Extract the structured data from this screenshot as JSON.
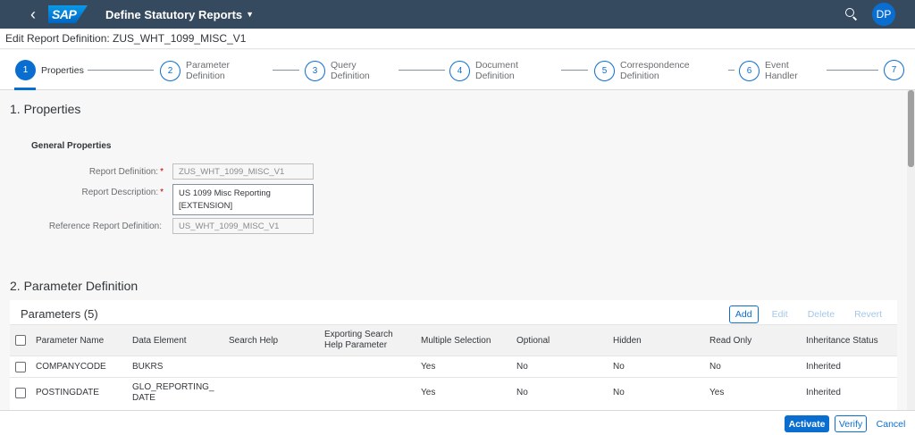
{
  "shell": {
    "logo": "SAP",
    "title": "Define Statutory Reports",
    "avatar_initials": "DP",
    "icons": {
      "back": "back-arrow-icon",
      "search": "search-icon",
      "title_menu": "chevron-down-icon"
    }
  },
  "subheader": {
    "title": "Edit Report Definition: ZUS_WHT_1099_MISC_V1"
  },
  "wizard": {
    "steps": [
      {
        "num": "1",
        "label": "Properties"
      },
      {
        "num": "2",
        "label": "Parameter Definition"
      },
      {
        "num": "3",
        "label": "Query Definition"
      },
      {
        "num": "4",
        "label": "Document Definition"
      },
      {
        "num": "5",
        "label": "Correspondence Definition"
      },
      {
        "num": "6",
        "label": "Event Handler"
      },
      {
        "num": "7",
        "label": ""
      }
    ]
  },
  "section1": {
    "title": "1. Properties",
    "group_title": "General Properties",
    "fields": [
      {
        "label": "Report Definition:",
        "required": "*",
        "value": "ZUS_WHT_1099_MISC_V1"
      },
      {
        "label": "Report Description:",
        "required": "*",
        "value": "US 1099 Misc Reporting [EXTENSION]"
      },
      {
        "label": "Reference Report Definition:",
        "required": "",
        "value": "US_WHT_1099_MISC_V1"
      }
    ]
  },
  "section2": {
    "title": "2. Parameter Definition",
    "table_title": "Parameters (5)",
    "actions": {
      "add": "Add",
      "edit": "Edit",
      "delete": "Delete",
      "revert": "Revert"
    },
    "columns": [
      "Parameter Name",
      "Data Element",
      "Search Help",
      "Exporting Search Help Parameter",
      "Multiple Selection",
      "Optional",
      "Hidden",
      "Read Only",
      "Inheritance Status"
    ],
    "rows": [
      [
        "COMPANYCODE",
        "BUKRS",
        "",
        "",
        "Yes",
        "No",
        "No",
        "No",
        "Inherited"
      ],
      [
        "POSTINGDATE",
        "GLO_REPORTING_DATE",
        "",
        "",
        "Yes",
        "No",
        "No",
        "Yes",
        "Inherited"
      ]
    ]
  },
  "footer": {
    "activate": "Activate",
    "verify": "Verify",
    "cancel": "Cancel"
  },
  "colors": {
    "shell": "#354a5f",
    "accent": "#0a6ed1",
    "required": "#bb0000"
  }
}
